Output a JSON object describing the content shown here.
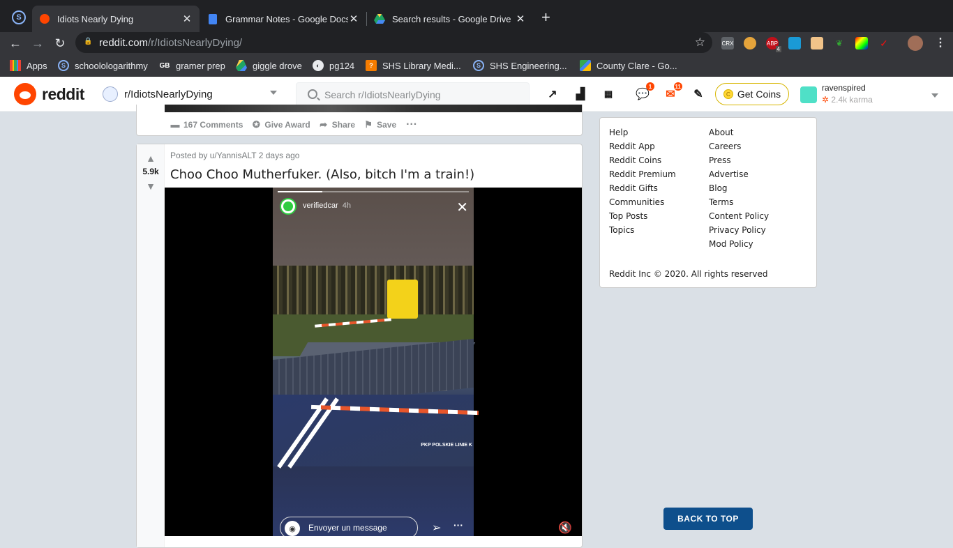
{
  "browser": {
    "tabs": [
      {
        "title": "Idiots Nearly Dying"
      },
      {
        "title": "Grammar Notes - Google Docs"
      },
      {
        "title": "Search results - Google Drive"
      }
    ],
    "url_domain": "reddit.com",
    "url_path": "/r/IdiotsNearlyDying/",
    "bookmarks": [
      {
        "label": "Apps"
      },
      {
        "label": "schoolologarithmy"
      },
      {
        "label": "gramer prep"
      },
      {
        "label": "giggle drove"
      },
      {
        "label": "pg124"
      },
      {
        "label": "SHS Library Medi..."
      },
      {
        "label": "SHS Engineering..."
      },
      {
        "label": "County Clare - Go..."
      }
    ],
    "ext_badges": {
      "abp": "4"
    }
  },
  "header": {
    "logo": "reddit",
    "subreddit": "r/IdiotsNearlyDying",
    "search_placeholder": "Search r/IdiotsNearlyDying",
    "chat_count": "1",
    "mail_count": "11",
    "coins_label": "Get Coins",
    "username": "ravenspired",
    "karma": "2.4k karma"
  },
  "prev_post": {
    "comments": "167 Comments",
    "award": "Give Award",
    "share": "Share",
    "save": "Save"
  },
  "post": {
    "score": "5.9k",
    "meta": "Posted by u/YannisALT 2 days ago",
    "title": "Choo Choo Mutherfuker. (Also, bitch I'm a train!)",
    "story_user": "verifiedcar",
    "story_time": "4h",
    "story_watermark": "PKP POLSKIE LINIE K",
    "message_placeholder": "Envoyer un message"
  },
  "footer": {
    "col1": [
      "Help",
      "Reddit App",
      "Reddit Coins",
      "Reddit Premium",
      "Reddit Gifts",
      "Communities",
      "Top Posts",
      "Topics"
    ],
    "col2": [
      "About",
      "Careers",
      "Press",
      "Advertise",
      "Blog",
      "Terms",
      "Content Policy",
      "Privacy Policy",
      "Mod Policy"
    ],
    "copyright": "Reddit Inc © 2020. All rights reserved"
  },
  "back_to_top": "BACK TO TOP",
  "colors": {
    "reddit_orange": "#ff4500",
    "back_to_top_blue": "#0e4f8c",
    "page_bg": "#dae0e6"
  }
}
